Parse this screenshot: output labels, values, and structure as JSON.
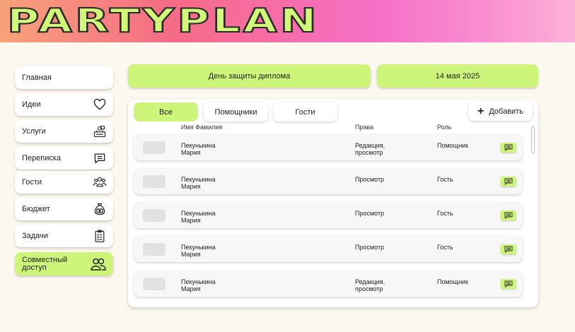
{
  "app": {
    "logo": "PARTYPLAN"
  },
  "sidebar": {
    "items": [
      {
        "label": "Главная",
        "icon": ""
      },
      {
        "label": "Идеи",
        "icon": "heart-icon"
      },
      {
        "label": "Услуги",
        "icon": "services-icon"
      },
      {
        "label": "Переписка",
        "icon": "chat-icon"
      },
      {
        "label": "Гости",
        "icon": "guests-icon"
      },
      {
        "label": "Бюджет",
        "icon": "money-bag-icon"
      },
      {
        "label": "Задачи",
        "icon": "checklist-icon"
      },
      {
        "label": "Совместный\nдоступ",
        "icon": "shared-users-icon",
        "active": true
      }
    ]
  },
  "event": {
    "name": "День защиты диплома",
    "date": "14 мая 2025"
  },
  "tabs": [
    {
      "label": "Все",
      "active": true
    },
    {
      "label": "Помощники",
      "active": false
    },
    {
      "label": "Гости",
      "active": false
    }
  ],
  "add_button": {
    "label": "Добавить"
  },
  "table": {
    "headers": {
      "name": "Имя Фамилия",
      "rights": "Права",
      "role": "Роль"
    },
    "rows": [
      {
        "name": "Пекунькина\nМария",
        "rights": "Редакция,\nпросмотр",
        "role": "Помощник"
      },
      {
        "name": "Пекунькина\nМария",
        "rights": "Просмотр",
        "role": "Гость"
      },
      {
        "name": "Пекунькина\nМария",
        "rights": "Просмотр",
        "role": "Гость"
      },
      {
        "name": "Пекунькина\nМария",
        "rights": "Просмотр",
        "role": "Гость"
      },
      {
        "name": "Пекунькина\nМария",
        "rights": "Редакция,\nпросмотр",
        "role": "Помощник"
      }
    ]
  },
  "colors": {
    "accent": "#ccf57a",
    "background": "#fdf8ef"
  }
}
